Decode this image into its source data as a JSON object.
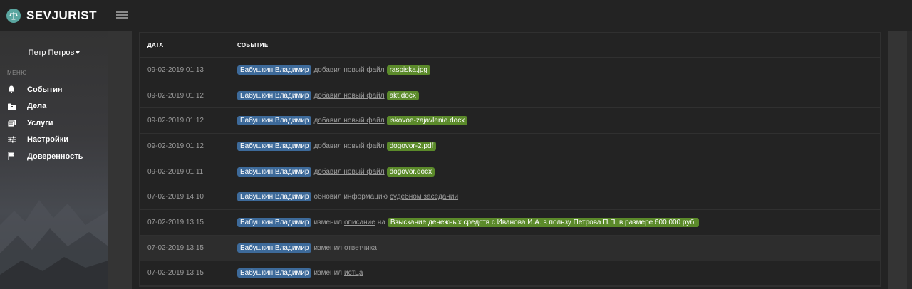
{
  "brand": {
    "name": "SEVJURIST"
  },
  "user": {
    "name": "Петр Петров"
  },
  "sidebar": {
    "menu_label": "МЕНЮ",
    "items": [
      {
        "label": "События",
        "icon": "bell-icon"
      },
      {
        "label": "Дела",
        "icon": "folder-icon"
      },
      {
        "label": "Услуги",
        "icon": "stack-icon"
      },
      {
        "label": "Настройки",
        "icon": "sliders-icon"
      },
      {
        "label": "Доверенность",
        "icon": "flag-icon"
      }
    ]
  },
  "table": {
    "headers": {
      "date": "ДАТА",
      "event": "СОБЫТИЕ"
    },
    "rows": [
      {
        "date": "09-02-2019 01:13",
        "user": "Бабушкин Владимир",
        "action": "добавил новый файл",
        "file": "raspiska.jpg"
      },
      {
        "date": "09-02-2019 01:12",
        "user": "Бабушкин Владимир",
        "action": "добавил новый файл",
        "file": "akt.docx"
      },
      {
        "date": "09-02-2019 01:12",
        "user": "Бабушкин Владимир",
        "action": "добавил новый файл",
        "file": "iskovoe-zajavlenie.docx"
      },
      {
        "date": "09-02-2019 01:12",
        "user": "Бабушкин Владимир",
        "action": "добавил новый файл",
        "file": "dogovor-2.pdf"
      },
      {
        "date": "09-02-2019 01:11",
        "user": "Бабушкин Владимир",
        "action": "добавил новый файл",
        "file": "dogovor.docx"
      },
      {
        "date": "07-02-2019 14:10",
        "user": "Бабушкин Владимир",
        "verb": "обновил информацию",
        "link": "судебном заседании"
      },
      {
        "date": "07-02-2019 13:15",
        "user": "Бабушкин Владимир",
        "verb": "изменил",
        "link": "описание",
        "mid": "на",
        "value": "Взыскание денежных средств с Иванова И.А. в пользу Петрова П.П. в размере 600 000 руб."
      },
      {
        "date": "07-02-2019 13:15",
        "user": "Бабушкин Владимир",
        "verb": "изменил",
        "link": "ответчика"
      },
      {
        "date": "07-02-2019 13:15",
        "user": "Бабушкин Владимир",
        "verb": "изменил",
        "link": "истца"
      }
    ]
  },
  "colors": {
    "user_badge": "#3d6a9a",
    "file_badge": "#5b8a2a",
    "logo": "#5aa6a0"
  }
}
